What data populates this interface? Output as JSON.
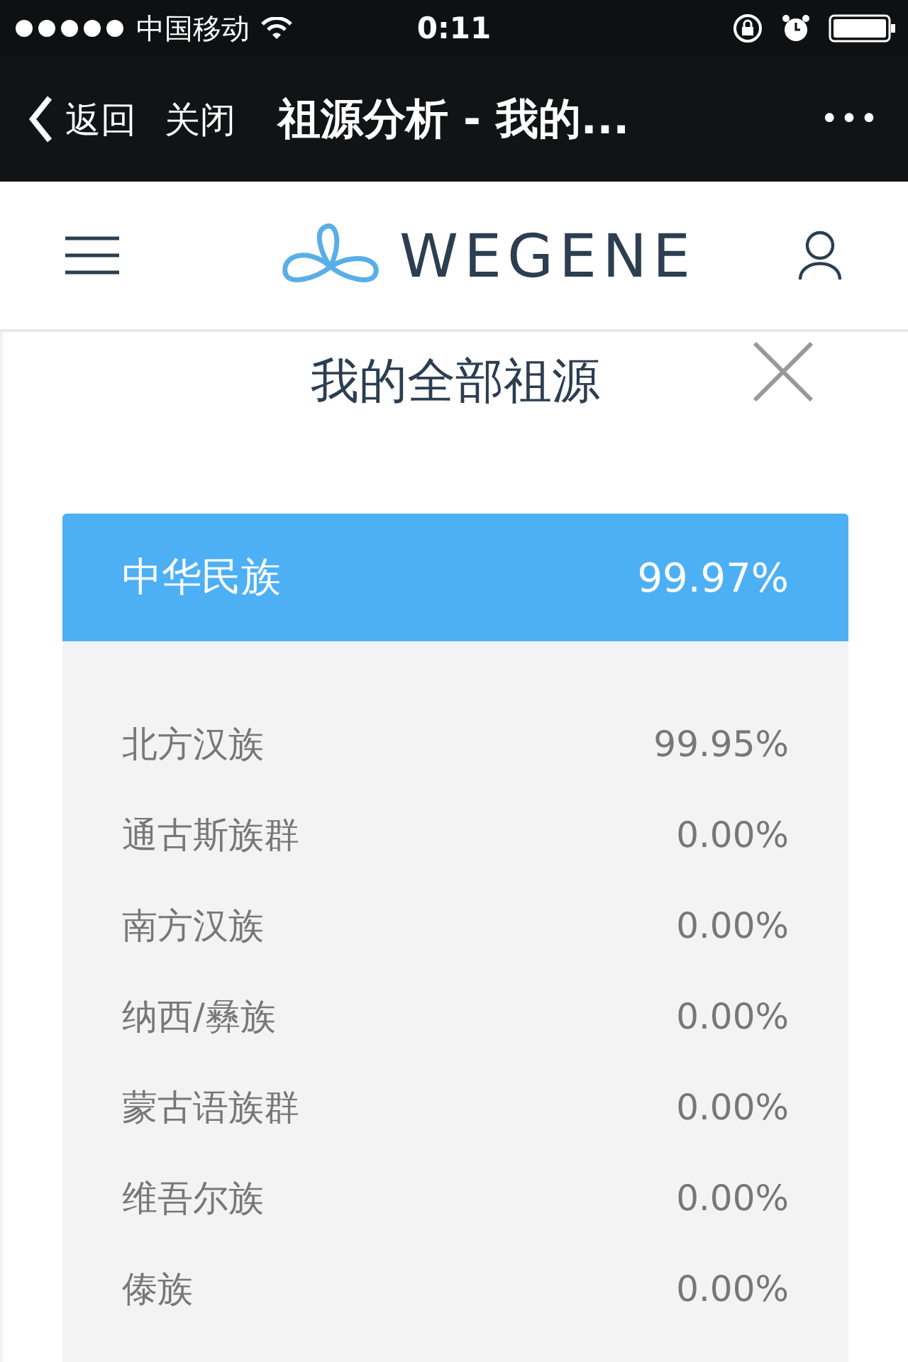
{
  "status_bar": {
    "carrier": "中国移动",
    "time": "0:11"
  },
  "nav_bar": {
    "back": "返回",
    "close": "关闭",
    "title": "祖源分析 - 我的...",
    "more": "•••"
  },
  "header": {
    "logo": "WEGENE"
  },
  "modal": {
    "title": "我的全部祖源",
    "group": {
      "name": "中华民族",
      "percent": "99.97%"
    },
    "items": [
      {
        "name": "北方汉族",
        "percent": "99.95%"
      },
      {
        "name": "通古斯族群",
        "percent": "0.00%"
      },
      {
        "name": "南方汉族",
        "percent": "0.00%"
      },
      {
        "name": "纳西/彝族",
        "percent": "0.00%"
      },
      {
        "name": "蒙古语族群",
        "percent": "0.00%"
      },
      {
        "name": "维吾尔族",
        "percent": "0.00%"
      },
      {
        "name": "傣族",
        "percent": "0.00%"
      }
    ]
  }
}
